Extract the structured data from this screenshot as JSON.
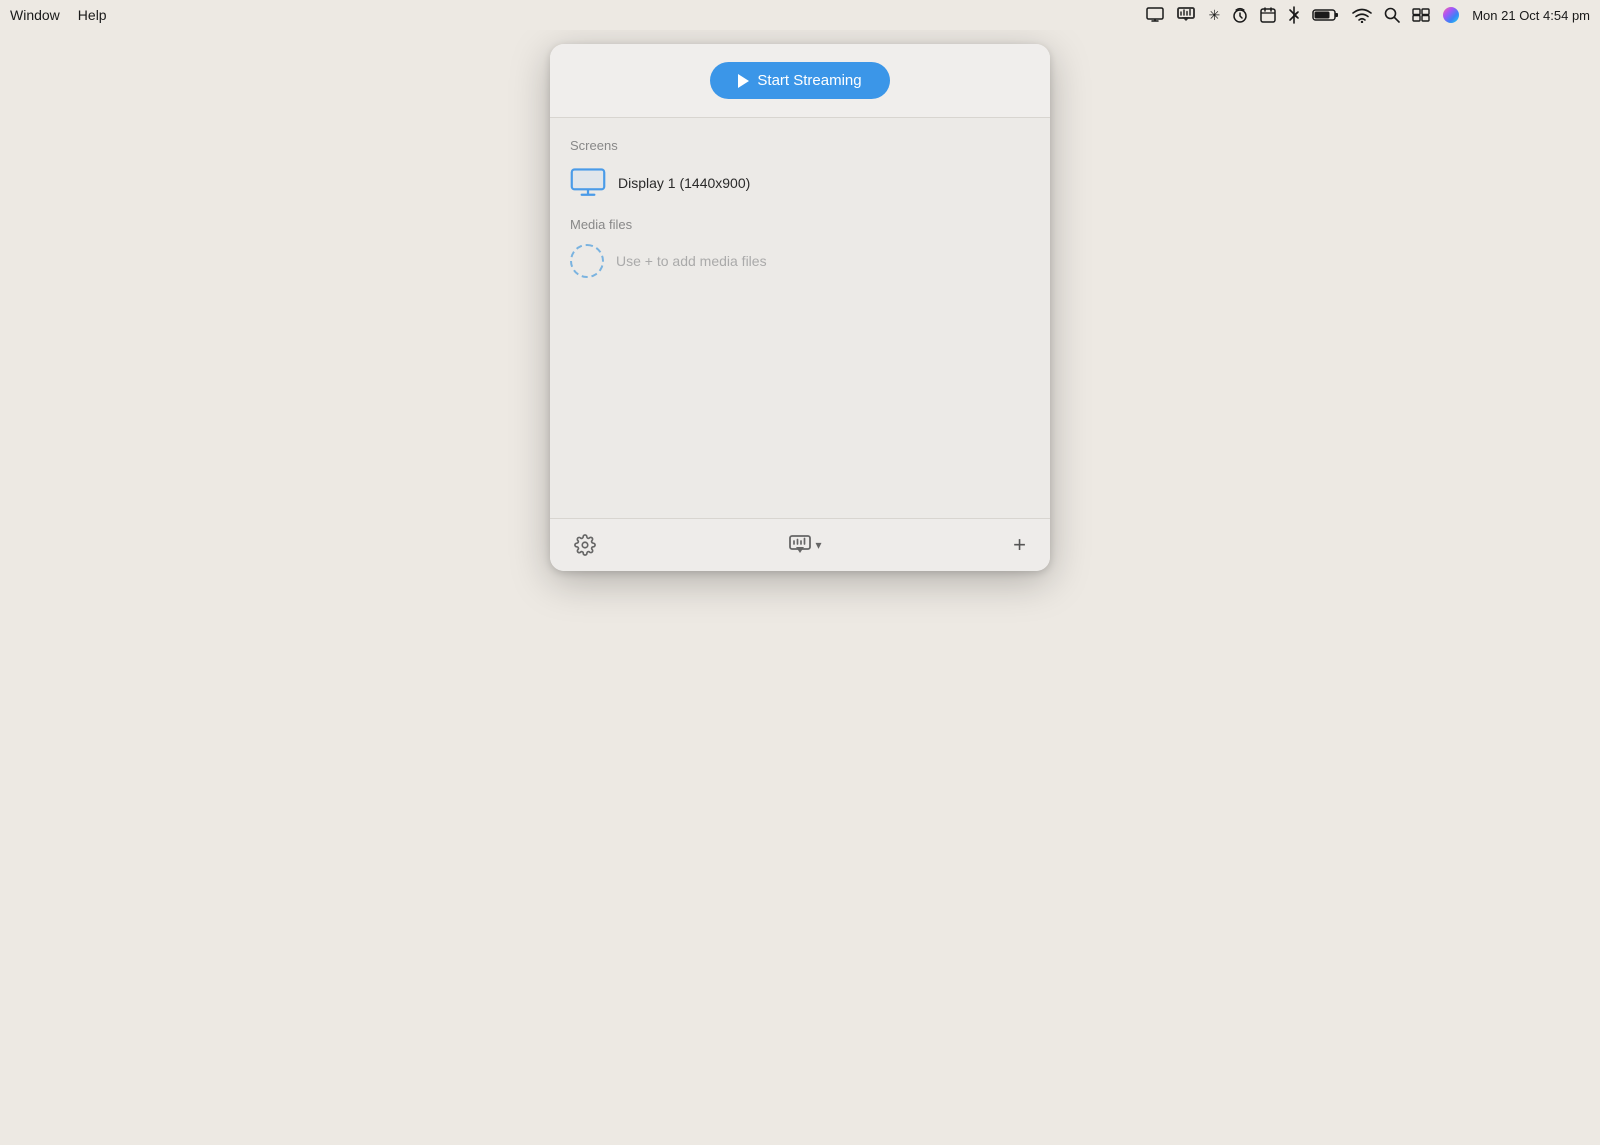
{
  "menubar": {
    "items": [
      {
        "id": "window",
        "label": "Window"
      },
      {
        "id": "help",
        "label": "Help"
      }
    ],
    "statusIcons": [
      "monitor-icon",
      "airplay-icon",
      "radnet-icon",
      "timemachine-icon",
      "calendar-icon",
      "bluetooth-icon",
      "battery-icon",
      "wifi-icon",
      "search-icon",
      "multiwindow-icon",
      "siri-icon"
    ],
    "clock": "Mon 21 Oct  4:54 pm"
  },
  "panel": {
    "startStreamingLabel": "Start Streaming",
    "sections": {
      "screens": {
        "label": "Screens",
        "items": [
          {
            "name": "Display 1 (1440x900)"
          }
        ]
      },
      "mediaFiles": {
        "label": "Media files",
        "placeholder": "Use + to add media files"
      }
    },
    "footer": {
      "settingsLabel": "Settings",
      "castLabel": "Cast",
      "addLabel": "Add"
    }
  }
}
